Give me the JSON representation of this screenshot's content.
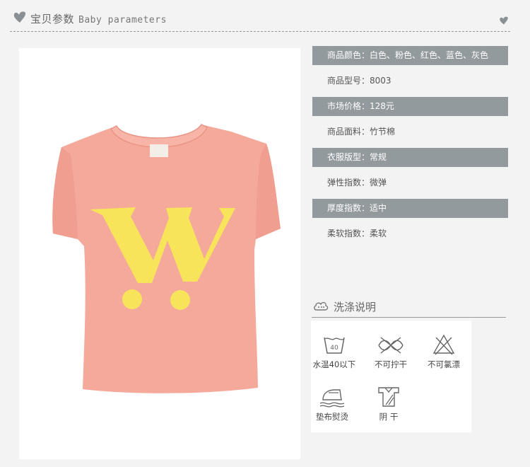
{
  "header": {
    "title_cn": "宝贝参数",
    "title_en": "Baby parameters"
  },
  "colors": {
    "background": "#f3f3f4",
    "bar": "#939a9e",
    "shirt": "#f5a99b",
    "print": "#f7e45a"
  },
  "product_image": {
    "alt": "pink t-shirt with yellow W print"
  },
  "params": [
    {
      "text": "商品颜色：白色、粉色、红色、蓝色、灰色",
      "style": "dark"
    },
    {
      "text": "商品型号：8003",
      "style": "light"
    },
    {
      "text": "市场价格：128元",
      "style": "dark"
    },
    {
      "text": "商品面料：竹节棉",
      "style": "light"
    },
    {
      "text": "衣服版型：常规",
      "style": "dark"
    },
    {
      "text": "弹性指数：微弹",
      "style": "light"
    },
    {
      "text": "厚度指数：适中",
      "style": "dark"
    },
    {
      "text": "柔软指数：柔软",
      "style": "light"
    }
  ],
  "washing": {
    "title": "洗涤说明",
    "tub_temp": "40",
    "items": [
      {
        "icon": "wash-40-icon",
        "label": "水温40以下"
      },
      {
        "icon": "no-wring-icon",
        "label": "不可拧干"
      },
      {
        "icon": "no-bleach-icon",
        "label": "不可氯漂"
      },
      {
        "icon": "iron-with-cloth-icon",
        "label": "垫布熨烫"
      },
      {
        "icon": "shade-dry-icon",
        "label": "阴 干"
      }
    ]
  }
}
